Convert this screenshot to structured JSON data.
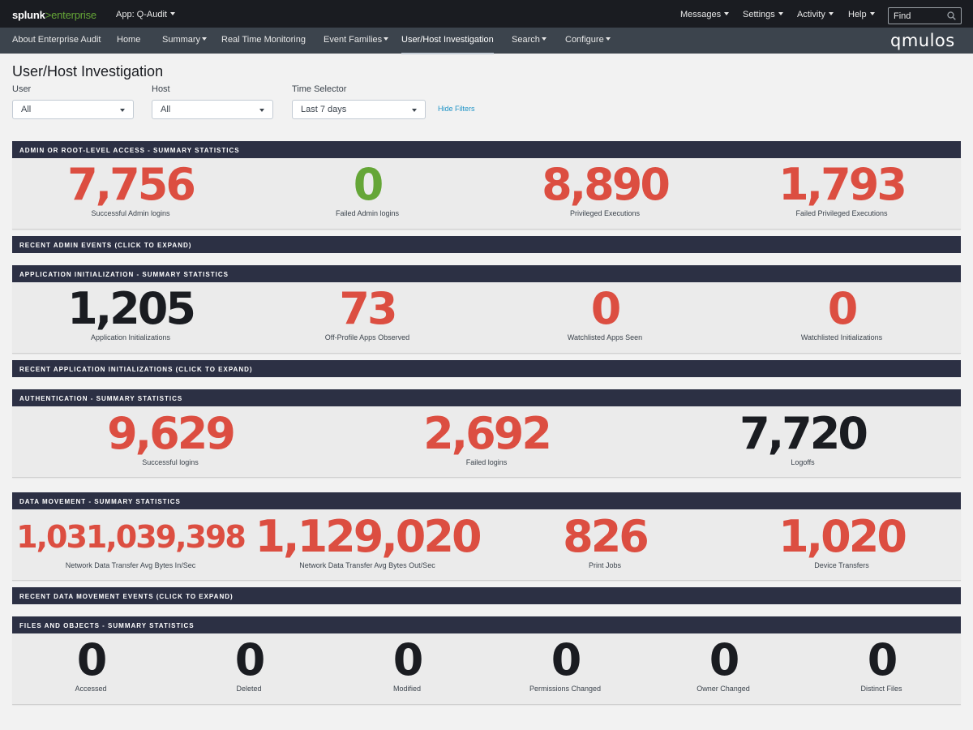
{
  "topbar": {
    "logo_main": "splunk",
    "logo_gt": ">",
    "logo_ent": "enterprise",
    "app_label": "App: Q-Audit",
    "menus": [
      "Messages",
      "Settings",
      "Activity",
      "Help"
    ],
    "find_placeholder": "Find"
  },
  "nav": {
    "items": [
      "About Enterprise Audit",
      "Home",
      "Summary",
      "Real Time Monitoring",
      "Event Families",
      "User/Host Investigation",
      "Search",
      "Configure"
    ],
    "active": "User/Host Investigation",
    "brand": "qmulos"
  },
  "page": {
    "title": "User/Host Investigation",
    "filters": [
      {
        "label": "User",
        "value": "All"
      },
      {
        "label": "Host",
        "value": "All"
      },
      {
        "label": "Time Selector",
        "value": "Last 7 days"
      }
    ],
    "hide_filters": "Hide Filters"
  },
  "panels": [
    {
      "title": "ADMIN OR ROOT-LEVEL ACCESS - SUMMARY STATISTICS",
      "stats": [
        {
          "value": "7,756",
          "label": "Successful Admin logins",
          "color": "#dc4e41"
        },
        {
          "value": "0",
          "label": "Failed Admin logins",
          "color": "#65a637"
        },
        {
          "value": "8,890",
          "label": "Privileged Executions",
          "color": "#dc4e41"
        },
        {
          "value": "1,793",
          "label": "Failed Privileged Executions",
          "color": "#dc4e41"
        }
      ]
    },
    {
      "title": "RECENT ADMIN EVENTS (CLICK TO EXPAND)"
    },
    {
      "title": "APPLICATION INITIALIZATION - SUMMARY STATISTICS",
      "stats": [
        {
          "value": "1,205",
          "label": "Application Initializations",
          "color": "#1a1c21"
        },
        {
          "value": "73",
          "label": "Off-Profile Apps Observed",
          "color": "#dc4e41"
        },
        {
          "value": "0",
          "label": "Watchlisted Apps Seen",
          "color": "#dc4e41"
        },
        {
          "value": "0",
          "label": "Watchlisted Initializations",
          "color": "#dc4e41"
        }
      ]
    },
    {
      "title": "RECENT APPLICATION INITIALIZATIONS (CLICK TO EXPAND)"
    },
    {
      "title": "AUTHENTICATION - SUMMARY STATISTICS",
      "stats": [
        {
          "value": "9,629",
          "label": "Successful logins",
          "color": "#dc4e41"
        },
        {
          "value": "2,692",
          "label": "Failed logins",
          "color": "#dc4e41"
        },
        {
          "value": "7,720",
          "label": "Logoffs",
          "color": "#1a1c21"
        }
      ]
    },
    {
      "title": "DATA MOVEMENT - SUMMARY STATISTICS",
      "stats": [
        {
          "value": "1,031,039,398",
          "label": "Network Data Transfer Avg Bytes In/Sec",
          "color": "#dc4e41"
        },
        {
          "value": "1,129,020",
          "label": "Network Data Transfer Avg Bytes Out/Sec",
          "color": "#dc4e41"
        },
        {
          "value": "826",
          "label": "Print Jobs",
          "color": "#dc4e41"
        },
        {
          "value": "1,020",
          "label": "Device Transfers",
          "color": "#dc4e41"
        }
      ]
    },
    {
      "title": "RECENT DATA MOVEMENT EVENTS (CLICK TO EXPAND)"
    },
    {
      "title": "FILES AND OBJECTS - SUMMARY STATISTICS",
      "stats": [
        {
          "value": "0",
          "label": "Accessed",
          "color": "#1a1c21"
        },
        {
          "value": "0",
          "label": "Deleted",
          "color": "#1a1c21"
        },
        {
          "value": "0",
          "label": "Modified",
          "color": "#1a1c21"
        },
        {
          "value": "0",
          "label": "Permissions Changed",
          "color": "#1a1c21"
        },
        {
          "value": "0",
          "label": "Owner Changed",
          "color": "#1a1c21"
        },
        {
          "value": "0",
          "label": "Distinct Files",
          "color": "#1a1c21"
        }
      ]
    }
  ]
}
